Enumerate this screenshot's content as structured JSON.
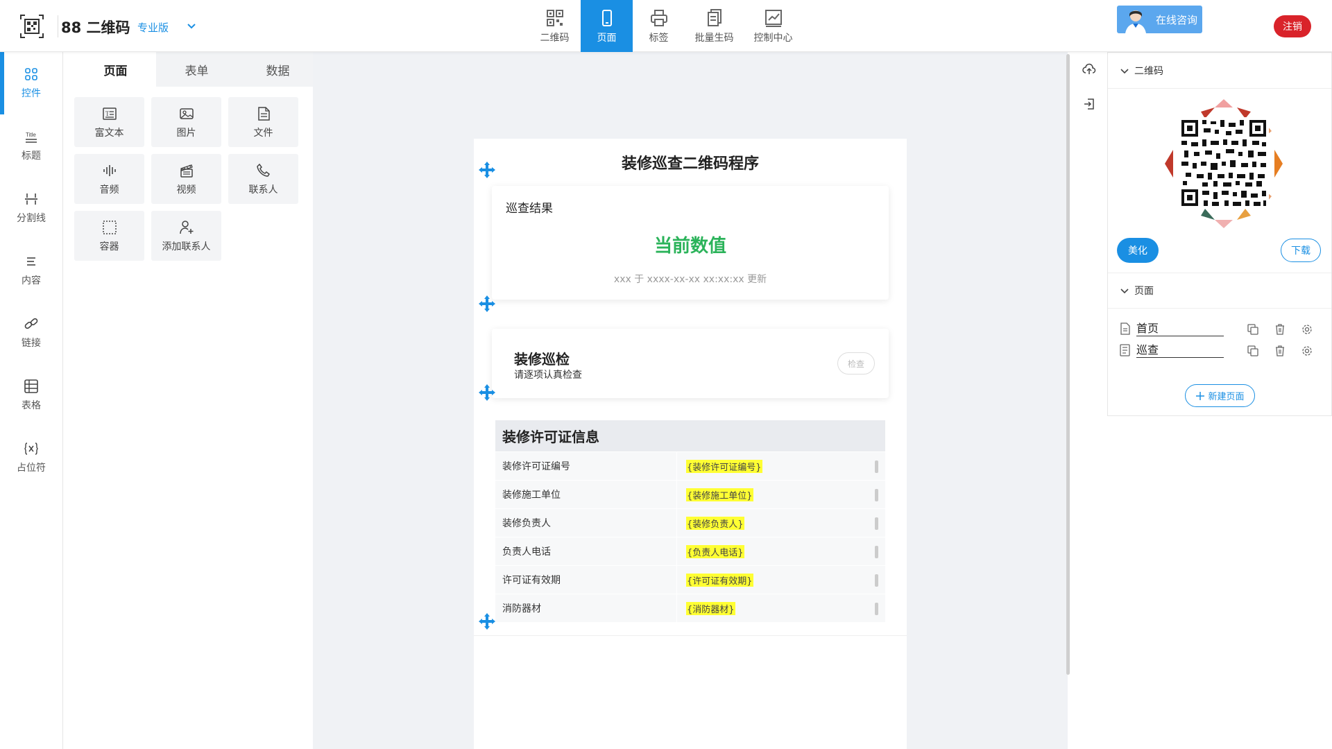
{
  "app": {
    "brand": "88 二维码",
    "edition": "专业版"
  },
  "top_nav": [
    {
      "label": "二维码",
      "icon": "qrcode-icon"
    },
    {
      "label": "页面",
      "icon": "phone-icon",
      "active": true
    },
    {
      "label": "标签",
      "icon": "printer-icon"
    },
    {
      "label": "批量生码",
      "icon": "batch-icon"
    },
    {
      "label": "控制中心",
      "icon": "dashboard-icon"
    }
  ],
  "header_right": {
    "consult_label": "在线咨询",
    "logout_label": "注销"
  },
  "left_rail": [
    {
      "label": "控件",
      "icon": "grid-icon",
      "active": true
    },
    {
      "label": "标题",
      "icon": "title-icon"
    },
    {
      "label": "分割线",
      "icon": "divider-icon"
    },
    {
      "label": "内容",
      "icon": "content-icon"
    },
    {
      "label": "链接",
      "icon": "link-icon"
    },
    {
      "label": "表格",
      "icon": "table-icon"
    },
    {
      "label": "占位符",
      "icon": "placeholder-icon"
    }
  ],
  "widget_tabs": [
    {
      "label": "页面",
      "active": true
    },
    {
      "label": "表单"
    },
    {
      "label": "数据"
    }
  ],
  "widgets": [
    {
      "label": "富文本",
      "icon": "rich-text-icon"
    },
    {
      "label": "图片",
      "icon": "image-icon"
    },
    {
      "label": "文件",
      "icon": "file-icon"
    },
    {
      "label": "音频",
      "icon": "audio-icon"
    },
    {
      "label": "视频",
      "icon": "video-icon"
    },
    {
      "label": "联系人",
      "icon": "phone-call-icon"
    },
    {
      "label": "容器",
      "icon": "container-icon"
    },
    {
      "label": "添加联系人",
      "icon": "add-contact-icon"
    }
  ],
  "preview": {
    "title": "装修巡查二维码程序",
    "card_result": {
      "title": "巡查结果",
      "value": "当前数值",
      "updated": "xxx 于 xxxx-xx-xx xx:xx:xx 更新"
    },
    "card_inspect": {
      "title": "装修巡检",
      "subtitle": "请逐项认真检查",
      "button": "检查"
    },
    "table": {
      "title": "装修许可证信息",
      "rows": [
        {
          "key": "装修许可证编号",
          "value": "{装修许可证编号}"
        },
        {
          "key": "装修施工单位",
          "value": "{装修施工单位}"
        },
        {
          "key": "装修负责人",
          "value": "{装修负责人}"
        },
        {
          "key": "负责人电话",
          "value": "{负责人电话}"
        },
        {
          "key": "许可证有效期",
          "value": "{许可证有效期}"
        },
        {
          "key": "消防器材",
          "value": "{消防器材}"
        }
      ]
    }
  },
  "right_panel": {
    "qr_section": {
      "title": "二维码",
      "beautify": "美化",
      "download": "下载"
    },
    "pages_section": {
      "title": "页面",
      "pages": [
        {
          "name": "首页"
        },
        {
          "name": "巡查"
        }
      ],
      "new_page": "新建页面"
    }
  },
  "colors": {
    "accent": "#1a8fe3",
    "danger": "#d9232a",
    "value_green": "#2bb35a",
    "placeholder_highlight": "#ffff33"
  }
}
